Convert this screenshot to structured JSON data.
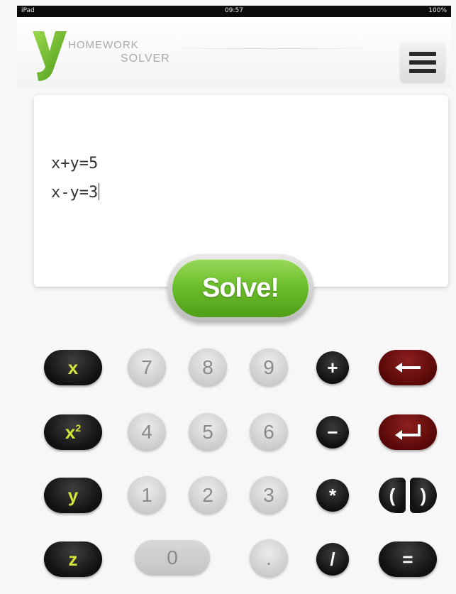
{
  "statusbar": {
    "left": "iPad",
    "center": "09:57",
    "right": "100%"
  },
  "header": {
    "logo_letter": "y",
    "logo_line1": "HOMEWORK",
    "logo_line2": "SOLVER",
    "menu_icon": "hamburger-menu-icon"
  },
  "editor": {
    "lines": [
      "x+y=5",
      "x-y=3"
    ]
  },
  "solve_button": {
    "label": "Solve!"
  },
  "keypad": {
    "x": "x",
    "x2": "x",
    "x2_exp": "2",
    "y": "y",
    "z": "z",
    "n7": "7",
    "n8": "8",
    "n9": "9",
    "n4": "4",
    "n5": "5",
    "n6": "6",
    "n1": "1",
    "n2": "2",
    "n3": "3",
    "n0": "0",
    "dot": ".",
    "plus": "+",
    "minus": "−",
    "times": "*",
    "divide": "/",
    "open_paren": "(",
    "close_paren": ")",
    "equals": "=",
    "backspace_icon": "left-arrow-icon",
    "enter_icon": "return-arrow-icon"
  },
  "colors": {
    "accent_green": "#6cbf2c",
    "variable_text": "#d2e43a",
    "delete_red": "#6e1010",
    "key_dark": "#111111"
  }
}
